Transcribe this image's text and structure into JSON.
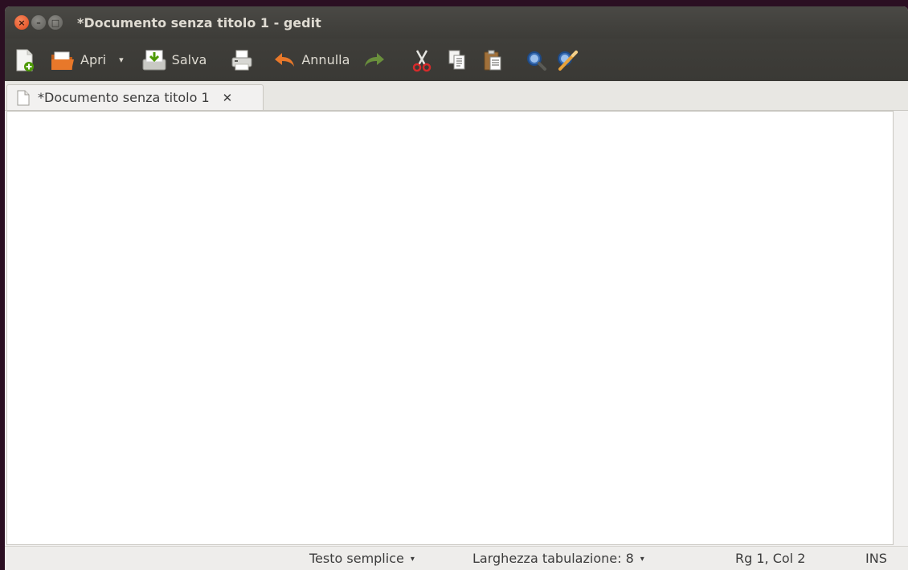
{
  "window": {
    "title": "*Documento senza titolo 1 - gedit",
    "buttons": {
      "close": "×",
      "minimize": "–",
      "maximize": "□"
    }
  },
  "toolbar": {
    "new_icon": "new-document-icon",
    "open_label": "Apri",
    "open_dropdown": "▾",
    "save_label": "Salva",
    "print_icon": "print-icon",
    "undo_label": "Annulla",
    "redo_icon": "redo-icon",
    "cut_icon": "cut-icon",
    "copy_icon": "copy-icon",
    "paste_icon": "paste-icon",
    "find_icon": "search-icon",
    "replace_icon": "search-replace-icon"
  },
  "tabs": [
    {
      "label": "*Documento senza titolo 1",
      "close": "✕"
    }
  ],
  "editor": {
    "content": ""
  },
  "statusbar": {
    "language": "Testo semplice",
    "language_arrow": "▾",
    "tab_width": "Larghezza tabulazione:  8",
    "tab_width_arrow": "▾",
    "position": "Rg 1, Col 2",
    "mode": "INS"
  },
  "colors": {
    "titlebar": "#3d3c38",
    "close_button": "#e0491c",
    "editor_bg": "#ffffff"
  }
}
